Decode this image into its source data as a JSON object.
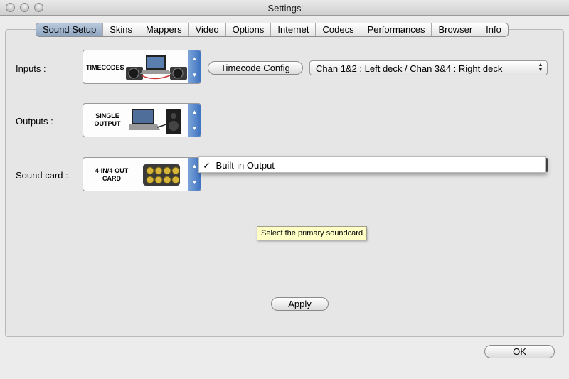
{
  "window": {
    "title": "Settings"
  },
  "tabs": [
    {
      "label": "Sound Setup",
      "selected": true
    },
    {
      "label": "Skins"
    },
    {
      "label": "Mappers"
    },
    {
      "label": "Video"
    },
    {
      "label": "Options"
    },
    {
      "label": "Internet"
    },
    {
      "label": "Codecs"
    },
    {
      "label": "Performances"
    },
    {
      "label": "Browser"
    },
    {
      "label": "Info"
    }
  ],
  "inputs": {
    "label": "Inputs :",
    "preset_text": "TIMECODES",
    "timecode_button": "Timecode Config",
    "channel_select": "Chan 1&2 : Left deck / Chan 3&4 : Right deck"
  },
  "outputs": {
    "label": "Outputs :",
    "preset_line1": "SINGLE",
    "preset_line2": "OUTPUT"
  },
  "soundcard": {
    "label": "Sound card :",
    "preset_line1": "4-IN/4-OUT",
    "preset_line2": "CARD",
    "menu_checkmark": "✓",
    "menu_item": "Built-in Output"
  },
  "tooltip": "Select the primary soundcard",
  "apply_label": "Apply",
  "ok_label": "OK",
  "colors": {
    "selected_tab": "#9aaecb",
    "stepper": "#4f80c8",
    "tooltip_bg": "#ffffc6"
  }
}
